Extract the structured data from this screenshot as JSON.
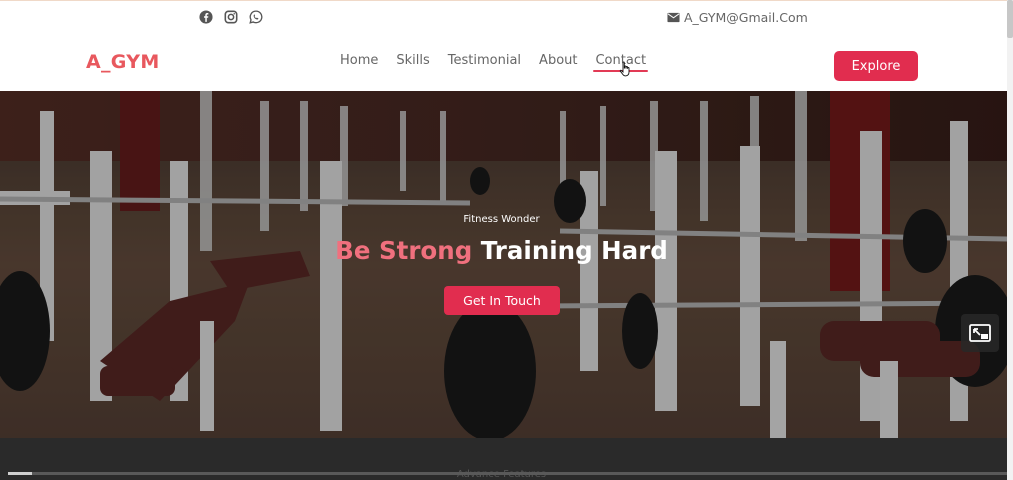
{
  "topbar": {
    "social_icons": [
      "facebook-icon",
      "instagram-icon",
      "whatsapp-icon"
    ],
    "mail_icon": "envelope-icon",
    "email": "A_GYM@Gmail.Com"
  },
  "navbar": {
    "logo": "A_GYM",
    "menu": [
      "Home",
      "Skills",
      "Testimonial",
      "About",
      "Contact"
    ],
    "active_item": "Contact",
    "explore_label": "Explore"
  },
  "hero": {
    "subtitle": "Fitness Wonder",
    "title_accent": "Be Strong",
    "title_rest": "Training Hard",
    "button_label": "Get In Touch",
    "pip_icon": "picture-in-picture-icon"
  },
  "section": {
    "title": "Advance Features"
  },
  "colors": {
    "brand": "#e8585e",
    "button": "#e12d4f",
    "accent_text": "#f0707e",
    "dark_bg": "#2a2a2a"
  }
}
